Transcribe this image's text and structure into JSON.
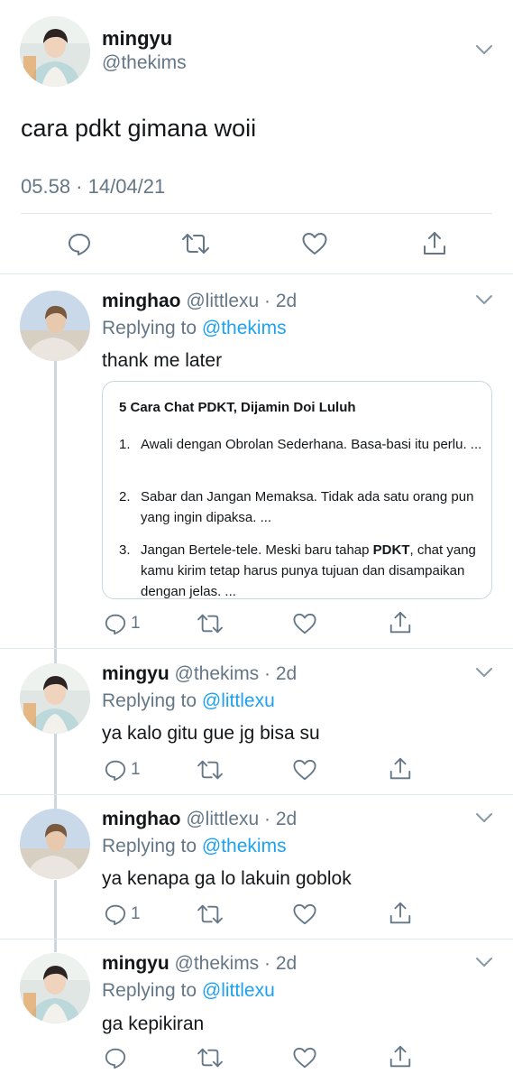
{
  "main_tweet": {
    "name": "mingyu",
    "handle": "@thekims",
    "text": "cara pdkt gimana woii",
    "timestamp": "05.58 · 14/04/21"
  },
  "replies": [
    {
      "name": "minghao",
      "handle": "@littlexu",
      "age": "· 2d",
      "replying_prefix": "Replying to",
      "replying_to": "@thekims",
      "text": "thank me later",
      "reply_count": "1",
      "card": {
        "title": "5 Cara Chat PDKT, Dijamin Doi Luluh",
        "items": [
          {
            "num": "1.",
            "text": "Awali dengan Obrolan Sederhana. Basa-basi itu perlu. ..."
          },
          {
            "num": "2.",
            "text": "Sabar dan Jangan Memaksa. Tidak ada satu orang pun yang ingin dipaksa. ..."
          },
          {
            "num": "3.",
            "text_before": "Jangan Bertele-tele. Meski baru tahap ",
            "text_bold": "PDKT",
            "text_after": ", chat yang kamu kirim tetap harus punya tujuan dan disampaikan dengan jelas. ..."
          }
        ]
      }
    },
    {
      "name": "mingyu",
      "handle": "@thekims",
      "age": "· 2d",
      "replying_prefix": "Replying to",
      "replying_to": "@littlexu",
      "text": "ya kalo gitu gue jg bisa su",
      "reply_count": "1"
    },
    {
      "name": "minghao",
      "handle": "@littlexu",
      "age": "· 2d",
      "replying_prefix": "Replying to",
      "replying_to": "@thekims",
      "text": "ya kenapa ga lo lakuin goblok",
      "reply_count": "1"
    },
    {
      "name": "mingyu",
      "handle": "@thekims",
      "age": "· 2d",
      "replying_prefix": "Replying to",
      "replying_to": "@littlexu",
      "text": "ga kepikiran",
      "reply_count": ""
    }
  ],
  "icons": {
    "reply": "reply-icon",
    "retweet": "retweet-icon",
    "like": "heart-icon",
    "share": "share-icon",
    "more": "chevron-down-icon"
  },
  "colors": {
    "text": "#14171a",
    "muted": "#657786",
    "link": "#1da1f2",
    "divider": "#e1e8ed"
  }
}
